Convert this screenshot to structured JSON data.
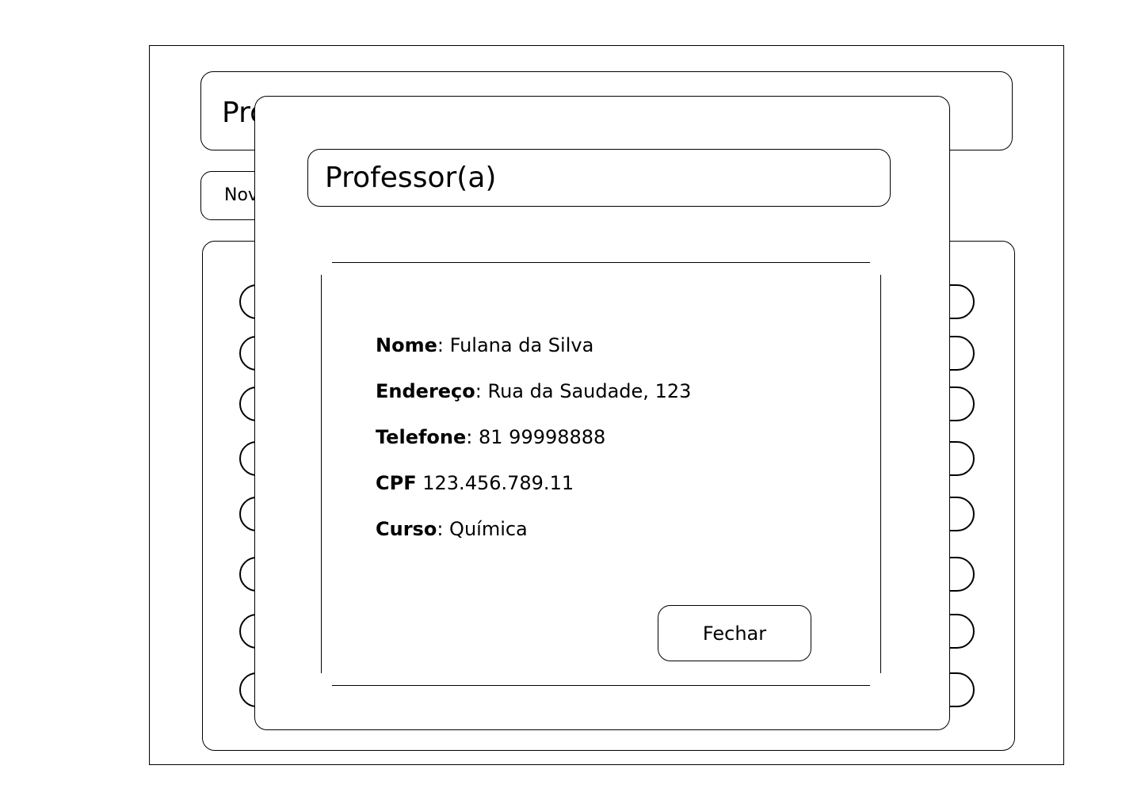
{
  "background": {
    "header_title": "Professores",
    "new_button_label": "Novo"
  },
  "modal": {
    "title": "Professor(a)",
    "details": [
      {
        "label": "Nome",
        "sep": ":",
        "value": "Fulana da Silva"
      },
      {
        "label": "Endereço",
        "sep": ":",
        "value": "Rua da Saudade, 123"
      },
      {
        "label": "Telefone",
        "sep": ":",
        "value": "81 99998888"
      },
      {
        "label": "CPF",
        "sep": "",
        "value": "123.456.789.11"
      },
      {
        "label": "Curso",
        "sep": ":",
        "value": "Química"
      }
    ],
    "close_label": "Fechar"
  }
}
